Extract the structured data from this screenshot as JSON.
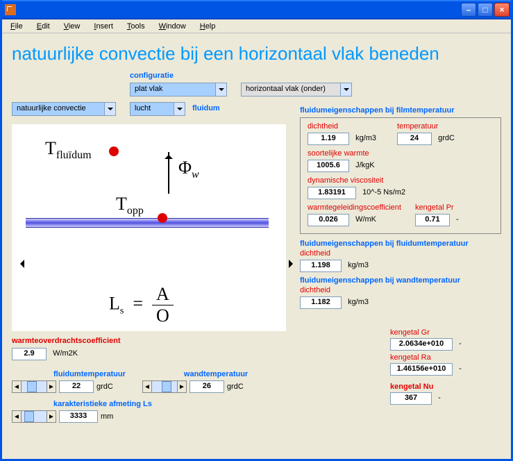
{
  "window": {
    "title": ""
  },
  "menu": {
    "file": "File",
    "edit": "Edit",
    "view": "View",
    "insert": "Insert",
    "tools": "Tools",
    "window": "Window",
    "help": "Help"
  },
  "page_title": "natuurlijke convectie bij een horizontaal vlak beneden",
  "config": {
    "label": "configuratie",
    "shape": "plat vlak",
    "orientation": "horizontaal vlak (onder)"
  },
  "flow_mode": "natuurlijke convectie",
  "fluid_label": "fluidum",
  "fluid": "lucht",
  "film_props": {
    "heading": "fluidumeigenschappen bij filmtemperatuur",
    "density_label": "dichtheid",
    "density": "1.19",
    "density_unit": "kg/m3",
    "temp_label": "temperatuur",
    "temp": "24",
    "temp_unit": "grdC",
    "cp_label": "soortelijke warmte",
    "cp": "1005.6",
    "cp_unit": "J/kgK",
    "mu_label": "dynamische viscositeit",
    "mu": "1.83191",
    "mu_unit": "10^-5 Ns/m2",
    "k_label": "warmtegeleidingscoefficient",
    "k": "0.026",
    "k_unit": "W/mK",
    "pr_label": "kengetal Pr",
    "pr": "0.71",
    "pr_unit": "-"
  },
  "fluid_temp_props": {
    "heading": "fluidumeigenschappen bij fluidumtemperatuur",
    "density_label": "dichtheid",
    "density": "1.198",
    "density_unit": "kg/m3"
  },
  "wall_temp_props": {
    "heading": "fluidumeigenschappen bij wandtemperatuur",
    "density_label": "dichtheid",
    "density": "1.182",
    "density_unit": "kg/m3"
  },
  "results": {
    "h_label": "warmteoverdrachtscoefficient",
    "h": "2.9",
    "h_unit": "W/m2K",
    "gr_label": "kengetal Gr",
    "gr": "2.0634e+010",
    "gr_unit": "-",
    "ra_label": "kengetal Ra",
    "ra": "1.46156e+010",
    "ra_unit": "-",
    "nu_label": "kengetal Nu",
    "nu": "367",
    "nu_unit": "-"
  },
  "inputs": {
    "tfluid_label": "fluidumtemperatuur",
    "tfluid": "22",
    "tfluid_unit": "grdC",
    "twall_label": "wandtemperatuur",
    "twall": "26",
    "twall_unit": "grdC",
    "ls_label": "karakteristieke afmeting Ls",
    "ls": "3333",
    "ls_unit": "mm"
  },
  "diagram": {
    "t_fluid": "T",
    "t_fluid_sub": "fluïdum",
    "t_opp": "T",
    "t_opp_sub": "opp",
    "phi": "Φ",
    "phi_sub": "w",
    "ls_eq_left": "L",
    "ls_eq_left_sub": "s",
    "ls_eq_eq": "=",
    "ls_eq_num": "A",
    "ls_eq_den": "O"
  }
}
